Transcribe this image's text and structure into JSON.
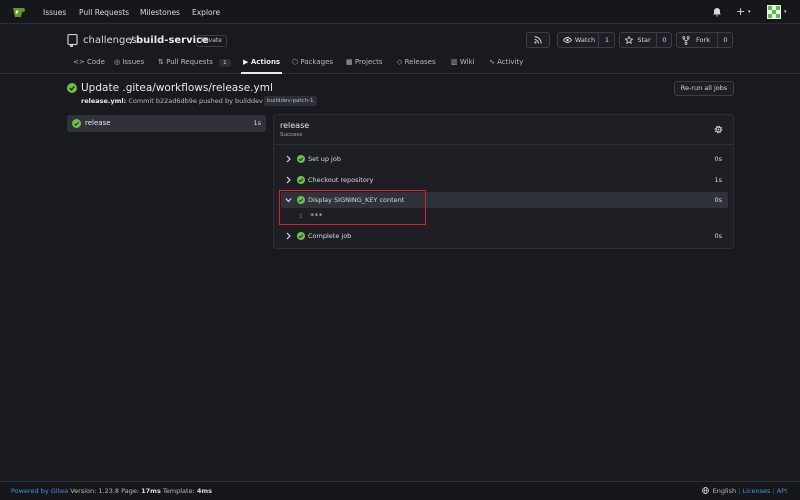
{
  "colors": {
    "background": "#181a1f",
    "success": "#6cc04a",
    "link": "#4b8ed8",
    "highlight": "#e0202a"
  },
  "navbar": {
    "logo_icon": "gitea-logo-icon",
    "links": [
      "Issues",
      "Pull Requests",
      "Milestones",
      "Explore"
    ],
    "bell_icon": "bell-icon",
    "create_icon": "plus-icon",
    "caret": "▾"
  },
  "repo": {
    "icon": "repo-icon",
    "owner": "challenges",
    "separator": "/",
    "name": "build-service",
    "visibility": "Private",
    "rss_icon": "rss-icon",
    "watch": {
      "label": "Watch",
      "count": "1"
    },
    "star": {
      "label": "Star",
      "count": "0"
    },
    "fork": {
      "label": "Fork",
      "count": "0"
    }
  },
  "tabs": [
    {
      "label": "Code",
      "icon": "code-icon"
    },
    {
      "label": "Issues",
      "icon": "issue-icon"
    },
    {
      "label": "Pull Requests",
      "icon": "pull-request-icon",
      "count": "1"
    },
    {
      "label": "Actions",
      "icon": "play-icon",
      "active": true
    },
    {
      "label": "Packages",
      "icon": "package-icon"
    },
    {
      "label": "Projects",
      "icon": "project-icon"
    },
    {
      "label": "Releases",
      "icon": "tag-icon"
    },
    {
      "label": "Wiki",
      "icon": "book-icon"
    },
    {
      "label": "Activity",
      "icon": "pulse-icon"
    }
  ],
  "run": {
    "title": "Update .gitea/workflows/release.yml",
    "workflow_file": "release.yml:",
    "commit_text": "Commit b22ad6db9e pushed by builddev",
    "branch": "builddev-patch-1",
    "rerun_label": "Re-run all jobs"
  },
  "jobs_list": [
    {
      "name": "release",
      "duration": "1s"
    }
  ],
  "job": {
    "name": "release",
    "status": "Success",
    "steps": [
      {
        "name": "Set up job",
        "duration": "0s"
      },
      {
        "name": "Checkout repository",
        "duration": "1s"
      },
      {
        "name": "Display SIGNING_KEY content",
        "duration": "0s",
        "expanded": true
      },
      {
        "name": "Complete job",
        "duration": "0s"
      }
    ],
    "log": {
      "line": "1",
      "text": "***"
    }
  },
  "footer": {
    "powered_by": "Powered by Gitea",
    "version": "Version: 1.23.8",
    "page_label": "Page:",
    "page_time": "17ms",
    "template_label": "Template:",
    "template_time": "4ms",
    "language": "English",
    "licenses": "Licenses",
    "api": "API"
  }
}
